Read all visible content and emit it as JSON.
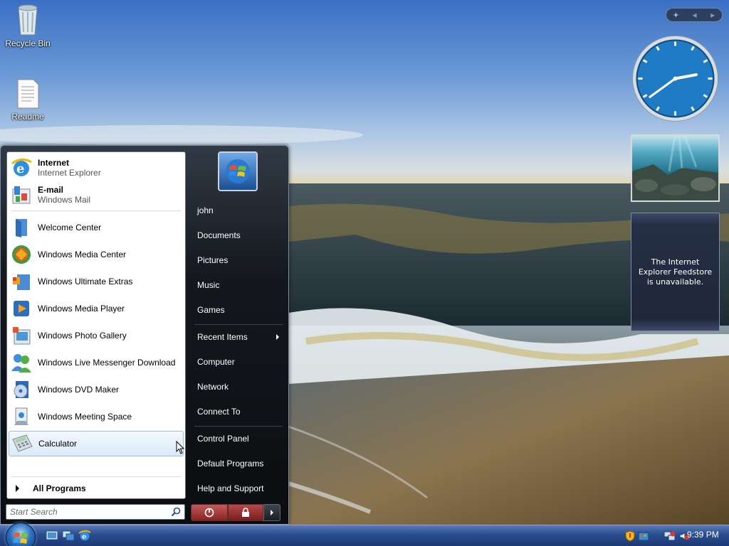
{
  "desktop": {
    "icons": [
      {
        "label": "Recycle Bin",
        "icon": "recycle-bin-icon"
      },
      {
        "label": "Readme",
        "icon": "document-icon"
      }
    ]
  },
  "gadgets": {
    "sidebar_controls": {
      "add": "+",
      "prev": "◂",
      "next": "▸"
    },
    "clock": {
      "hour": 2,
      "minute": 39
    },
    "feed_message": "The Internet Explorer Feedstore is unavailable."
  },
  "start_menu": {
    "pinned": [
      {
        "title": "Internet",
        "subtitle": "Internet Explorer",
        "icon": "internet-explorer-icon"
      },
      {
        "title": "E-mail",
        "subtitle": "Windows Mail",
        "icon": "windows-mail-icon"
      }
    ],
    "recent_programs": [
      {
        "label": "Welcome Center",
        "icon": "welcome-center-icon"
      },
      {
        "label": "Windows Media Center",
        "icon": "media-center-icon"
      },
      {
        "label": "Windows Ultimate Extras",
        "icon": "ultimate-extras-icon"
      },
      {
        "label": "Windows Media Player",
        "icon": "media-player-icon"
      },
      {
        "label": "Windows Photo Gallery",
        "icon": "photo-gallery-icon"
      },
      {
        "label": "Windows Live Messenger Download",
        "icon": "messenger-icon"
      },
      {
        "label": "Windows DVD Maker",
        "icon": "dvd-maker-icon"
      },
      {
        "label": "Windows Meeting Space",
        "icon": "meeting-space-icon"
      },
      {
        "label": "Calculator",
        "icon": "calculator-icon"
      }
    ],
    "all_programs": "All Programs",
    "search_placeholder": "Start Search",
    "right_links": {
      "user": "john",
      "documents": "Documents",
      "pictures": "Pictures",
      "music": "Music",
      "games": "Games",
      "recent_items": "Recent Items",
      "computer": "Computer",
      "network": "Network",
      "connect_to": "Connect To",
      "control_panel": "Control Panel",
      "default_programs": "Default Programs",
      "help_support": "Help and Support"
    }
  },
  "taskbar": {
    "clock": "9:39 PM"
  },
  "colors": {
    "start_menu_bg": "#14181d",
    "selection": "#dbeaf9",
    "taskbar": "#2a4c8e",
    "power_button": "#a83232"
  }
}
